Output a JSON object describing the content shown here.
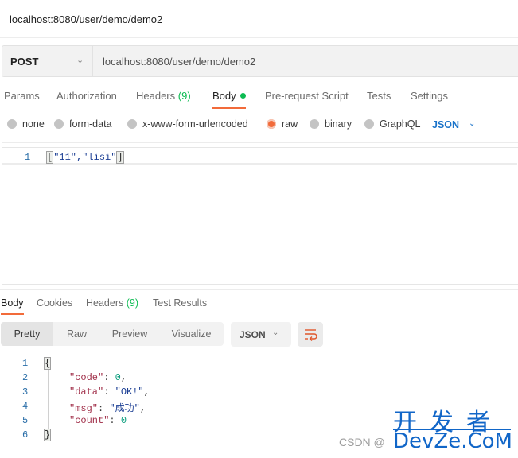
{
  "window": {
    "title": "localhost:8080/user/demo/demo2"
  },
  "request": {
    "method": "POST",
    "url": "localhost:8080/user/demo/demo2",
    "tabs": [
      {
        "label": "Params"
      },
      {
        "label": "Authorization"
      },
      {
        "label": "Headers",
        "count": "(9)"
      },
      {
        "label": "Body",
        "active": true,
        "indicator": "green-dot"
      },
      {
        "label": "Pre-request Script"
      },
      {
        "label": "Tests"
      },
      {
        "label": "Settings"
      }
    ],
    "body_types": [
      {
        "label": "none",
        "selected": false
      },
      {
        "label": "form-data",
        "selected": false
      },
      {
        "label": "x-www-form-urlencoded",
        "selected": false
      },
      {
        "label": "raw",
        "selected": true
      },
      {
        "label": "binary",
        "selected": false
      },
      {
        "label": "GraphQL",
        "selected": false
      }
    ],
    "raw_language": "JSON",
    "editor_lines": [
      {
        "num": "1",
        "text": "\"11\",\"lisi\"",
        "open": "[",
        "close": "]"
      }
    ]
  },
  "response": {
    "tabs": [
      {
        "label": "Body",
        "active": true
      },
      {
        "label": "Cookies"
      },
      {
        "label": "Headers",
        "count": "(9)"
      },
      {
        "label": "Test Results"
      }
    ],
    "view_modes": [
      {
        "label": "Pretty",
        "active": true
      },
      {
        "label": "Raw"
      },
      {
        "label": "Preview"
      },
      {
        "label": "Visualize"
      }
    ],
    "format": "JSON",
    "wrap_icon": "wrap-lines-icon",
    "lines": [
      {
        "num": "1",
        "open": "{"
      },
      {
        "num": "2",
        "key": "\"code\"",
        "sep": ": ",
        "value": "0",
        "vtype": "n",
        "trail": ","
      },
      {
        "num": "3",
        "key": "\"data\"",
        "sep": ": ",
        "value": "\"OK!\"",
        "vtype": "s",
        "trail": ","
      },
      {
        "num": "4",
        "key": "\"msg\"",
        "sep": ": ",
        "value": "\"成功\"",
        "vtype": "s",
        "trail": ","
      },
      {
        "num": "5",
        "key": "\"count\"",
        "sep": ": ",
        "value": "0",
        "vtype": "n",
        "trail": ""
      },
      {
        "num": "6",
        "close": "}"
      }
    ]
  },
  "watermark": {
    "csdn": "CSDN @",
    "brand_cn": "开发者",
    "brand_en": "DevZe.CoM"
  },
  "colors": {
    "accent": "#f26b3a",
    "success": "#0cbb52",
    "link": "#1a73c9"
  }
}
